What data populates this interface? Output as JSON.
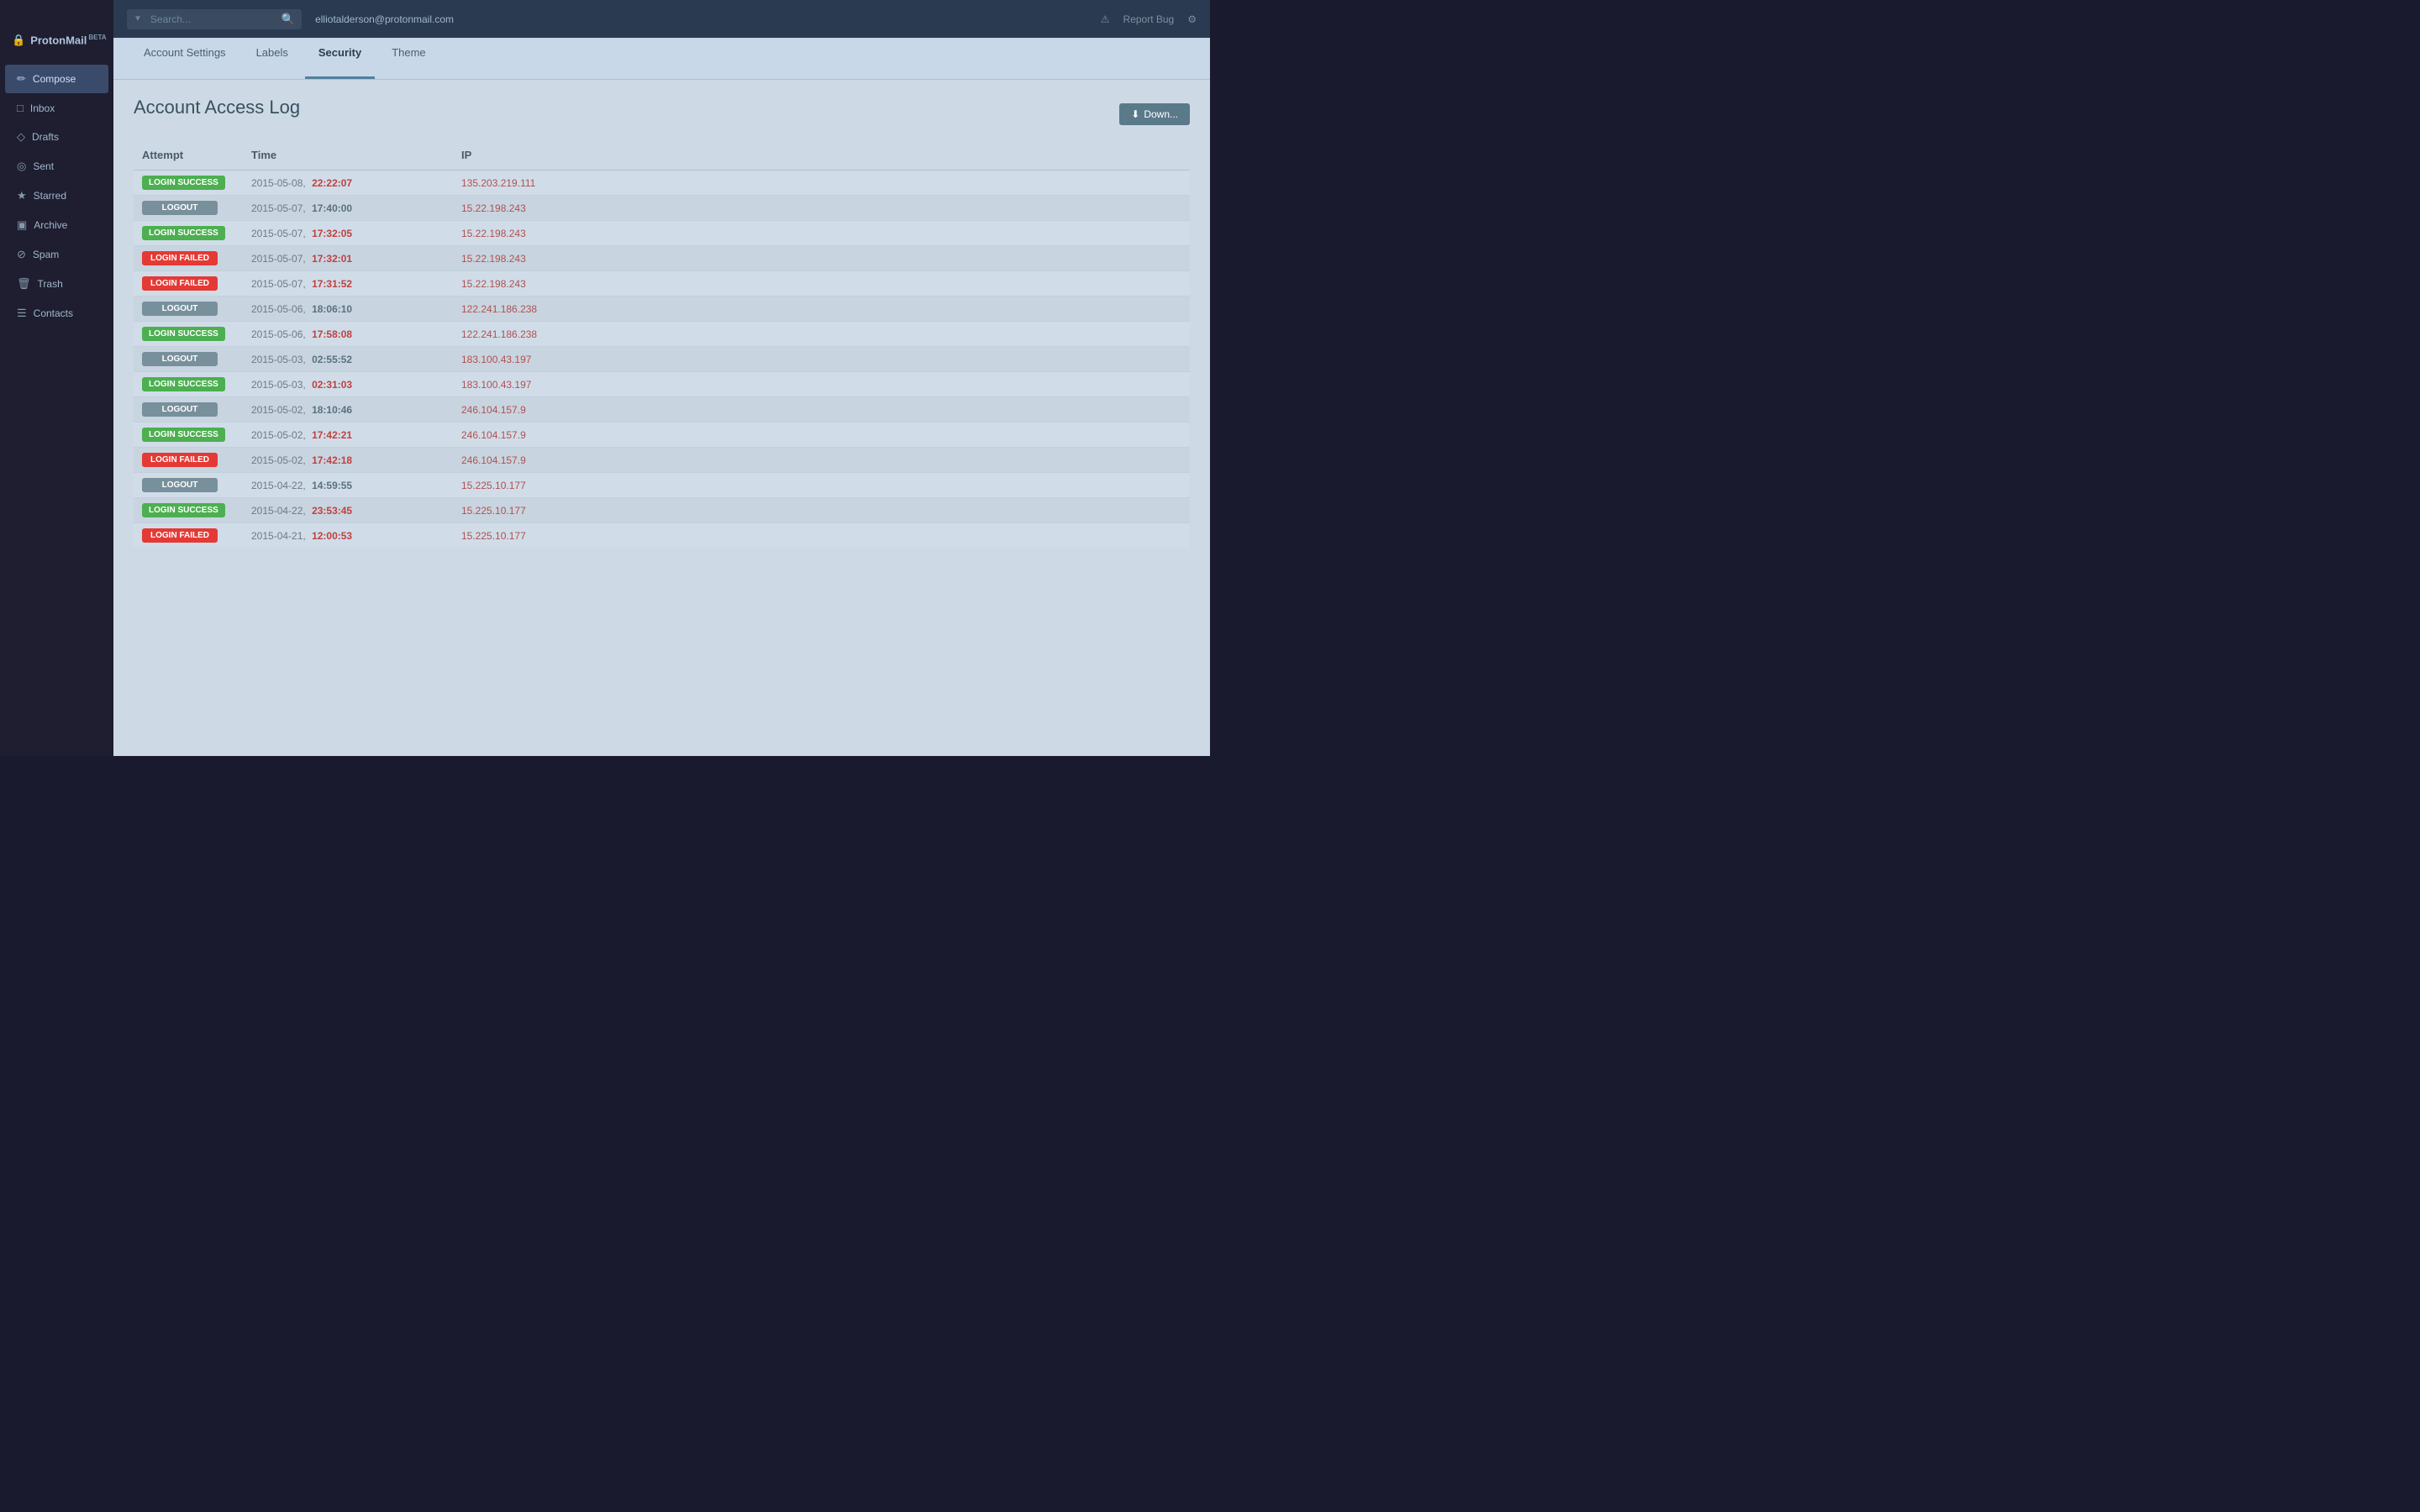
{
  "sidebar": {
    "logo": "ProtonMail",
    "beta": "BETA",
    "items": [
      {
        "id": "compose",
        "label": "Compose",
        "icon": "✏",
        "active": true
      },
      {
        "id": "inbox",
        "label": "Inbox",
        "icon": "□"
      },
      {
        "id": "drafts",
        "label": "Drafts",
        "icon": "◇"
      },
      {
        "id": "sent",
        "label": "Sent",
        "icon": "◎"
      },
      {
        "id": "starred",
        "label": "Starred",
        "icon": "★"
      },
      {
        "id": "archive",
        "label": "Archive",
        "icon": "▣"
      },
      {
        "id": "spam",
        "label": "Spam",
        "icon": "⊘"
      },
      {
        "id": "trash",
        "label": "Trash",
        "icon": "🗑"
      },
      {
        "id": "contacts",
        "label": "Contacts",
        "icon": "☰"
      }
    ]
  },
  "header": {
    "search_placeholder": "Search...",
    "email": "elliotalderson@protonmail.com",
    "report_bug": "Report Bug"
  },
  "tabs": [
    {
      "id": "account",
      "label": "Account Settings",
      "active": false
    },
    {
      "id": "labels",
      "label": "Labels",
      "active": false
    },
    {
      "id": "security",
      "label": "Security",
      "active": true
    },
    {
      "id": "theme",
      "label": "Theme",
      "active": false
    }
  ],
  "page": {
    "title": "Account Access Log",
    "download_label": "Down...",
    "columns": [
      "Attempt",
      "Time",
      "IP"
    ]
  },
  "log_entries": [
    {
      "type": "LOGIN SUCCESS",
      "badge_class": "badge-success",
      "date": "2015-05-08,",
      "time": "22:22:07",
      "ip": "135.203.219.111"
    },
    {
      "type": "LOGOUT",
      "badge_class": "badge-logout",
      "date": "2015-05-07,",
      "time": "17:40:00",
      "ip": "15.22.198.243"
    },
    {
      "type": "LOGIN SUCCESS",
      "badge_class": "badge-success",
      "date": "2015-05-07,",
      "time": "17:32:05",
      "ip": "15.22.198.243"
    },
    {
      "type": "LOGIN FAILED",
      "badge_class": "badge-failed",
      "date": "2015-05-07,",
      "time": "17:32:01",
      "ip": "15.22.198.243"
    },
    {
      "type": "LOGIN FAILED",
      "badge_class": "badge-failed",
      "date": "2015-05-07,",
      "time": "17:31:52",
      "ip": "15.22.198.243"
    },
    {
      "type": "LOGOUT",
      "badge_class": "badge-logout",
      "date": "2015-05-06,",
      "time": "18:06:10",
      "ip": "122.241.186.238"
    },
    {
      "type": "LOGIN SUCCESS",
      "badge_class": "badge-success",
      "date": "2015-05-06,",
      "time": "17:58:08",
      "ip": "122.241.186.238"
    },
    {
      "type": "LOGOUT",
      "badge_class": "badge-logout",
      "date": "2015-05-03,",
      "time": "02:55:52",
      "ip": "183.100.43.197"
    },
    {
      "type": "LOGIN SUCCESS",
      "badge_class": "badge-success",
      "date": "2015-05-03,",
      "time": "02:31:03",
      "ip": "183.100.43.197"
    },
    {
      "type": "LOGOUT",
      "badge_class": "badge-logout",
      "date": "2015-05-02,",
      "time": "18:10:46",
      "ip": "246.104.157.9"
    },
    {
      "type": "LOGIN SUCCESS",
      "badge_class": "badge-success",
      "date": "2015-05-02,",
      "time": "17:42:21",
      "ip": "246.104.157.9"
    },
    {
      "type": "LOGIN FAILED",
      "badge_class": "badge-failed",
      "date": "2015-05-02,",
      "time": "17:42:18",
      "ip": "246.104.157.9"
    },
    {
      "type": "LOGOUT",
      "badge_class": "badge-logout",
      "date": "2015-04-22,",
      "time": "14:59:55",
      "ip": "15.225.10.177"
    },
    {
      "type": "LOGIN SUCCESS",
      "badge_class": "badge-success",
      "date": "2015-04-22,",
      "time": "23:53:45",
      "ip": "15.225.10.177"
    },
    {
      "type": "LOGIN FAILED",
      "badge_class": "badge-failed",
      "date": "2015-04-21,",
      "time": "12:00:53",
      "ip": "15.225.10.177"
    }
  ]
}
